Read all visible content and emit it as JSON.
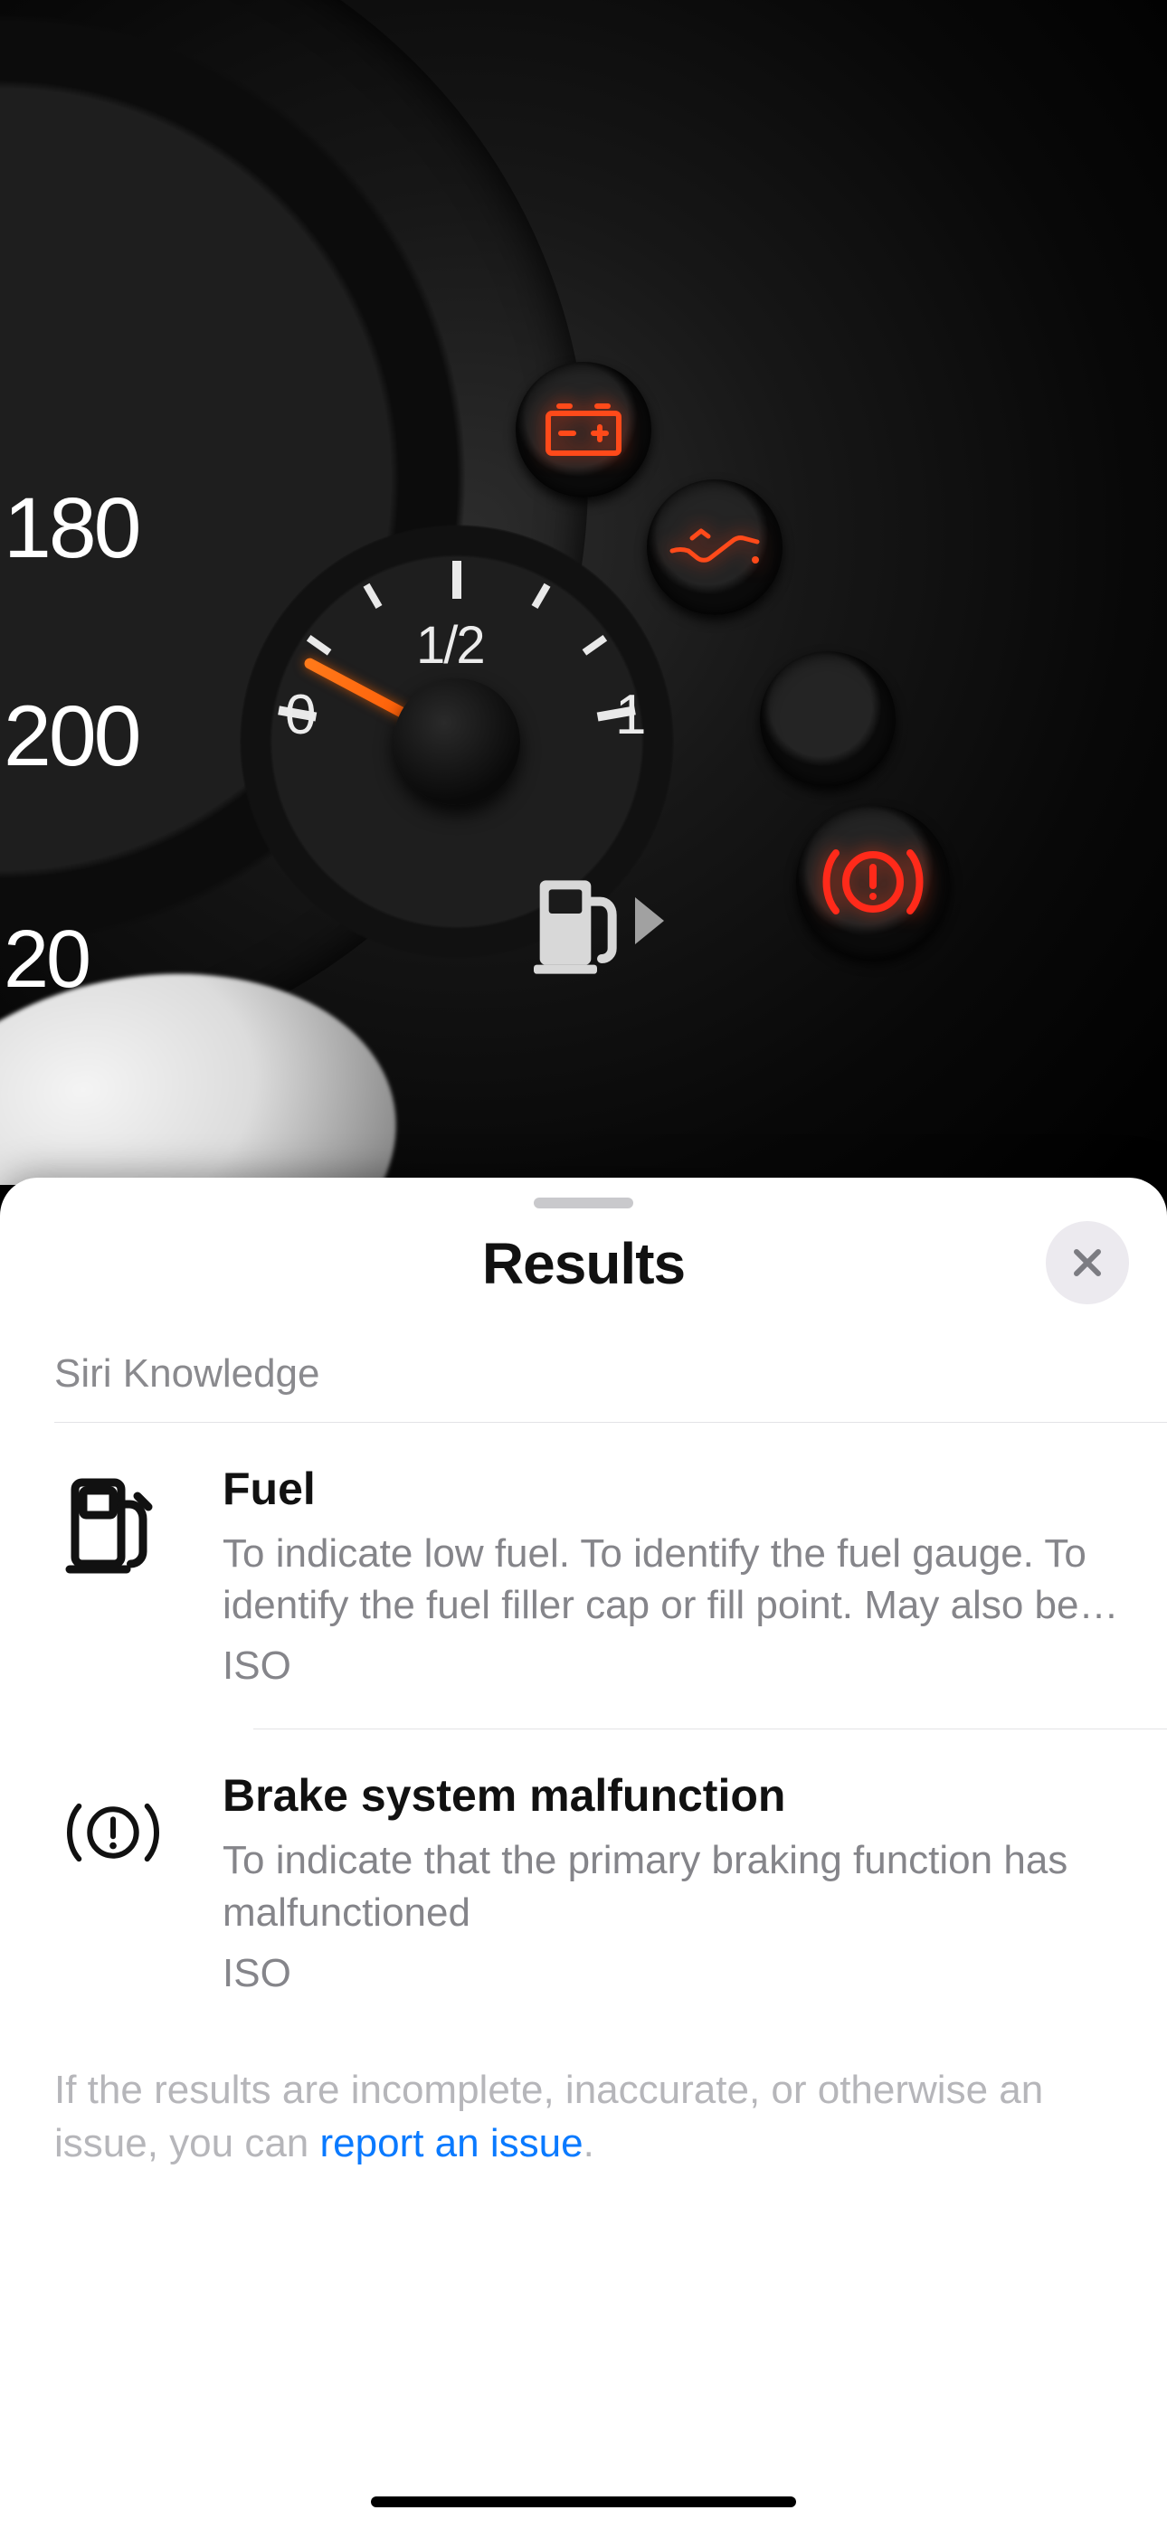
{
  "dashboard_photo": {
    "speedometer_visible_numbers": [
      "180",
      "200",
      "20"
    ],
    "fuel_gauge": {
      "labels": [
        "0",
        "1/2",
        "1"
      ],
      "needle_fraction": 0.15,
      "pump_side_arrow": "right"
    },
    "warning_lights": [
      {
        "name": "battery",
        "lit": true,
        "color": "#ff4a1a"
      },
      {
        "name": "oil-pressure",
        "lit": true,
        "color": "#ff4a1a"
      },
      {
        "name": "blank",
        "lit": false
      },
      {
        "name": "brake-system",
        "lit": true,
        "color": "#ff2a1a"
      }
    ]
  },
  "sheet": {
    "title": "Results",
    "section_label": "Siri Knowledge",
    "items": [
      {
        "icon": "fuel-pump-icon",
        "title": "Fuel",
        "description": "To indicate low fuel. To identify the fuel gauge. To identify the fuel filler cap or fill point. May also be use…",
        "source": "ISO"
      },
      {
        "icon": "brake-warning-icon",
        "title": "Brake system malfunction",
        "description": "To indicate that the primary braking function has malfunctioned",
        "source": "ISO"
      }
    ],
    "footer_prefix": "If the results are incomplete, inaccurate, or otherwise an issue, you can ",
    "footer_link": "report an issue",
    "footer_suffix": "."
  }
}
